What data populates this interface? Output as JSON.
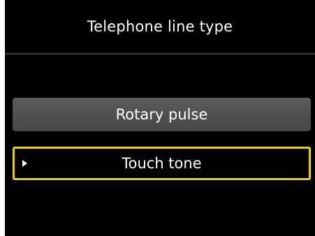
{
  "header": {
    "title": "Telephone line type"
  },
  "options": [
    {
      "label": "Rotary pulse",
      "selected": false
    },
    {
      "label": "Touch tone",
      "selected": true
    }
  ],
  "colors": {
    "background": "#000000",
    "selection_border": "#e6cf1c",
    "option_fill": "#505050",
    "text": "#ffffff"
  },
  "icons": {
    "selection_cursor": "right-triangle-icon"
  }
}
